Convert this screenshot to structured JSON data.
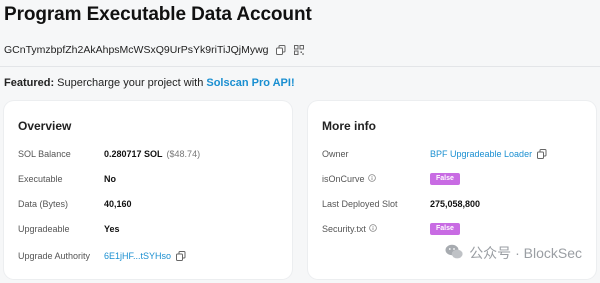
{
  "page": {
    "title": "Program Executable Data Account"
  },
  "address": {
    "value": "GCnTymzbpfZh2AkAhpsMcWSxQ9UrPsYk9riTiJQjMywg",
    "copy_icon": "copy-icon",
    "qr_icon": "qr-code-icon"
  },
  "featured": {
    "prefix": "Featured:",
    "text": " Supercharge your project with ",
    "link": "Solscan Pro API!"
  },
  "overview": {
    "title": "Overview",
    "sol_balance": {
      "label": "SOL Balance",
      "value": "0.280717 SOL",
      "usd": "($48.74)"
    },
    "executable": {
      "label": "Executable",
      "value": "No"
    },
    "data_bytes": {
      "label": "Data (Bytes)",
      "value": "40,160"
    },
    "upgradeable": {
      "label": "Upgradeable",
      "value": "Yes"
    },
    "upgrade_authority": {
      "label": "Upgrade Authority",
      "value": "6E1jHF...tSYHso"
    }
  },
  "more_info": {
    "title": "More info",
    "owner": {
      "label": "Owner",
      "value": "BPF Upgradeable Loader"
    },
    "is_on_curve": {
      "label": "isOnCurve",
      "value": "False"
    },
    "last_deployed_slot": {
      "label": "Last Deployed Slot",
      "value": "275,058,800"
    },
    "security_txt": {
      "label": "Security.txt",
      "value": "False"
    }
  },
  "watermark": {
    "text": "公众号 · BlockSec"
  },
  "colors": {
    "link": "#1a8fd1",
    "badge": "#c86be3",
    "background": "#f6f7f8"
  }
}
